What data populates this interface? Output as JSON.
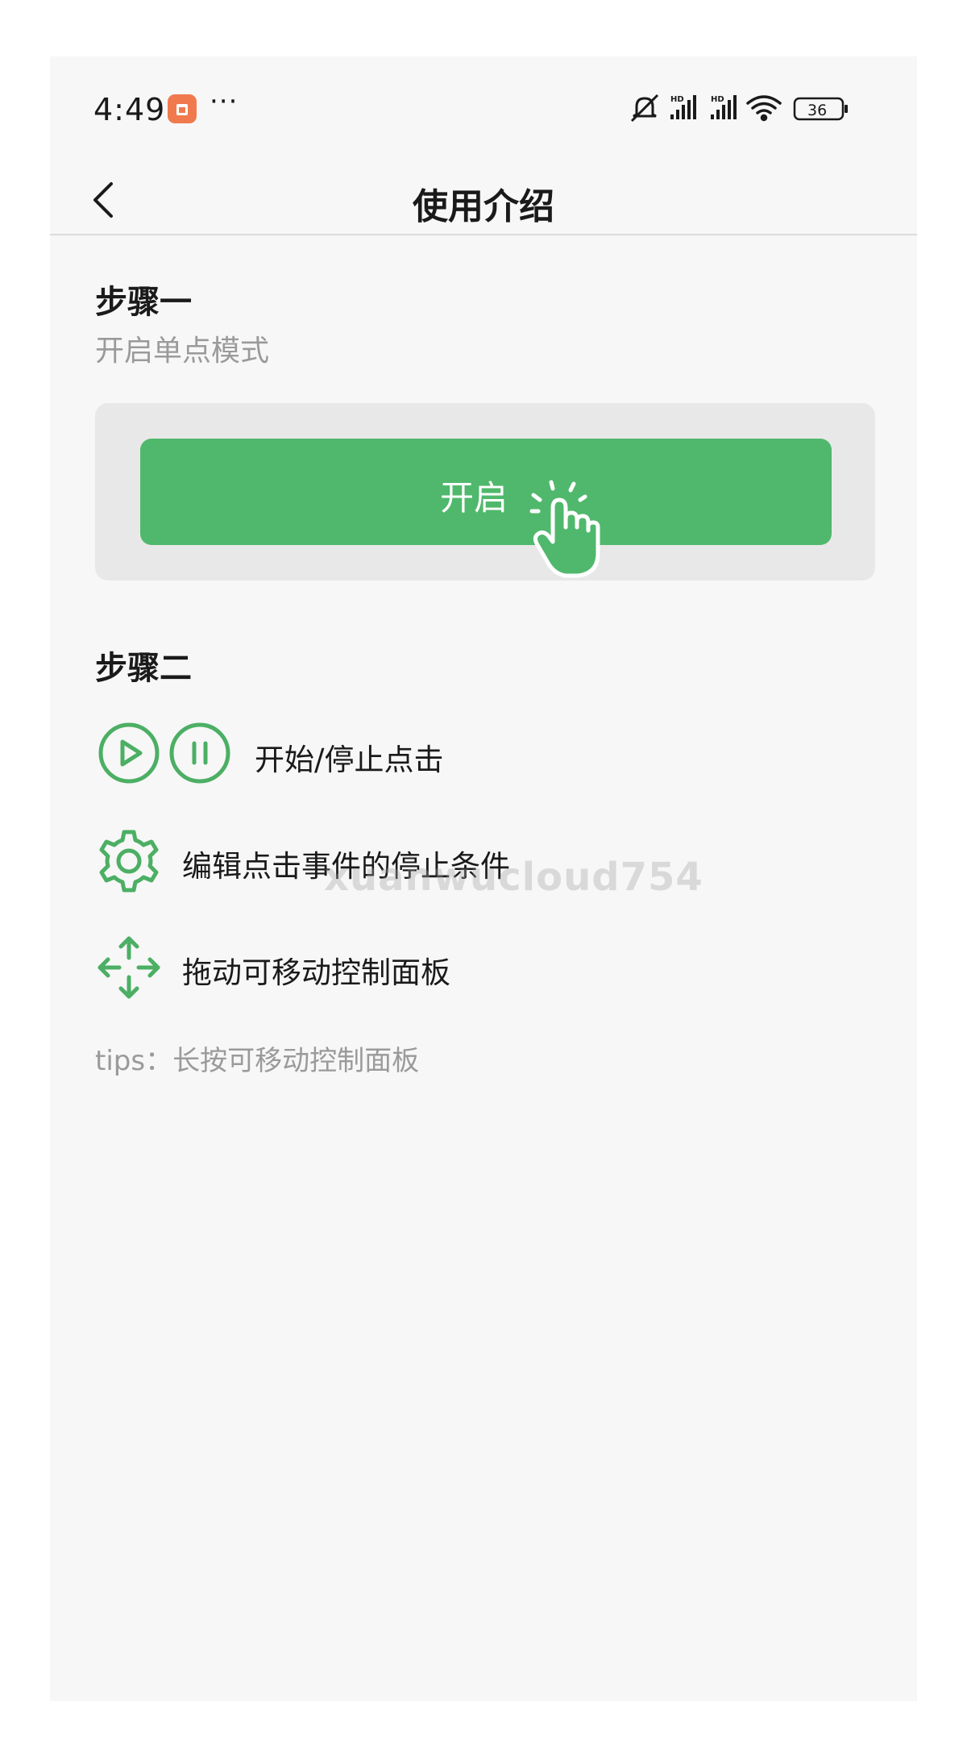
{
  "status_bar": {
    "time": "4:49",
    "more": "···",
    "battery": "36",
    "icons": [
      "mute-icon",
      "hd-signal-icon",
      "hd-signal-icon",
      "wifi-icon",
      "battery-icon"
    ]
  },
  "header": {
    "title": "使用介绍"
  },
  "step_one": {
    "heading": "步骤一",
    "subtitle": "开启单点模式",
    "button_label": "开启"
  },
  "step_two": {
    "heading": "步骤二",
    "items": [
      {
        "icons": [
          "play-icon",
          "pause-icon"
        ],
        "label": "开始/停止点击"
      },
      {
        "icons": [
          "gear-icon"
        ],
        "label": "编辑点击事件的停止条件"
      },
      {
        "icons": [
          "move-arrows-icon"
        ],
        "label": "拖动可移动控制面板"
      }
    ]
  },
  "tips": "tips：长按可移动控制面板",
  "watermark": "xuanwucloud754",
  "colors": {
    "accent": "#50b86c",
    "icon_green": "#4caf64",
    "background": "#f7f7f7",
    "panel": "#e8e8e8",
    "muted_text": "#9a9a9a"
  }
}
